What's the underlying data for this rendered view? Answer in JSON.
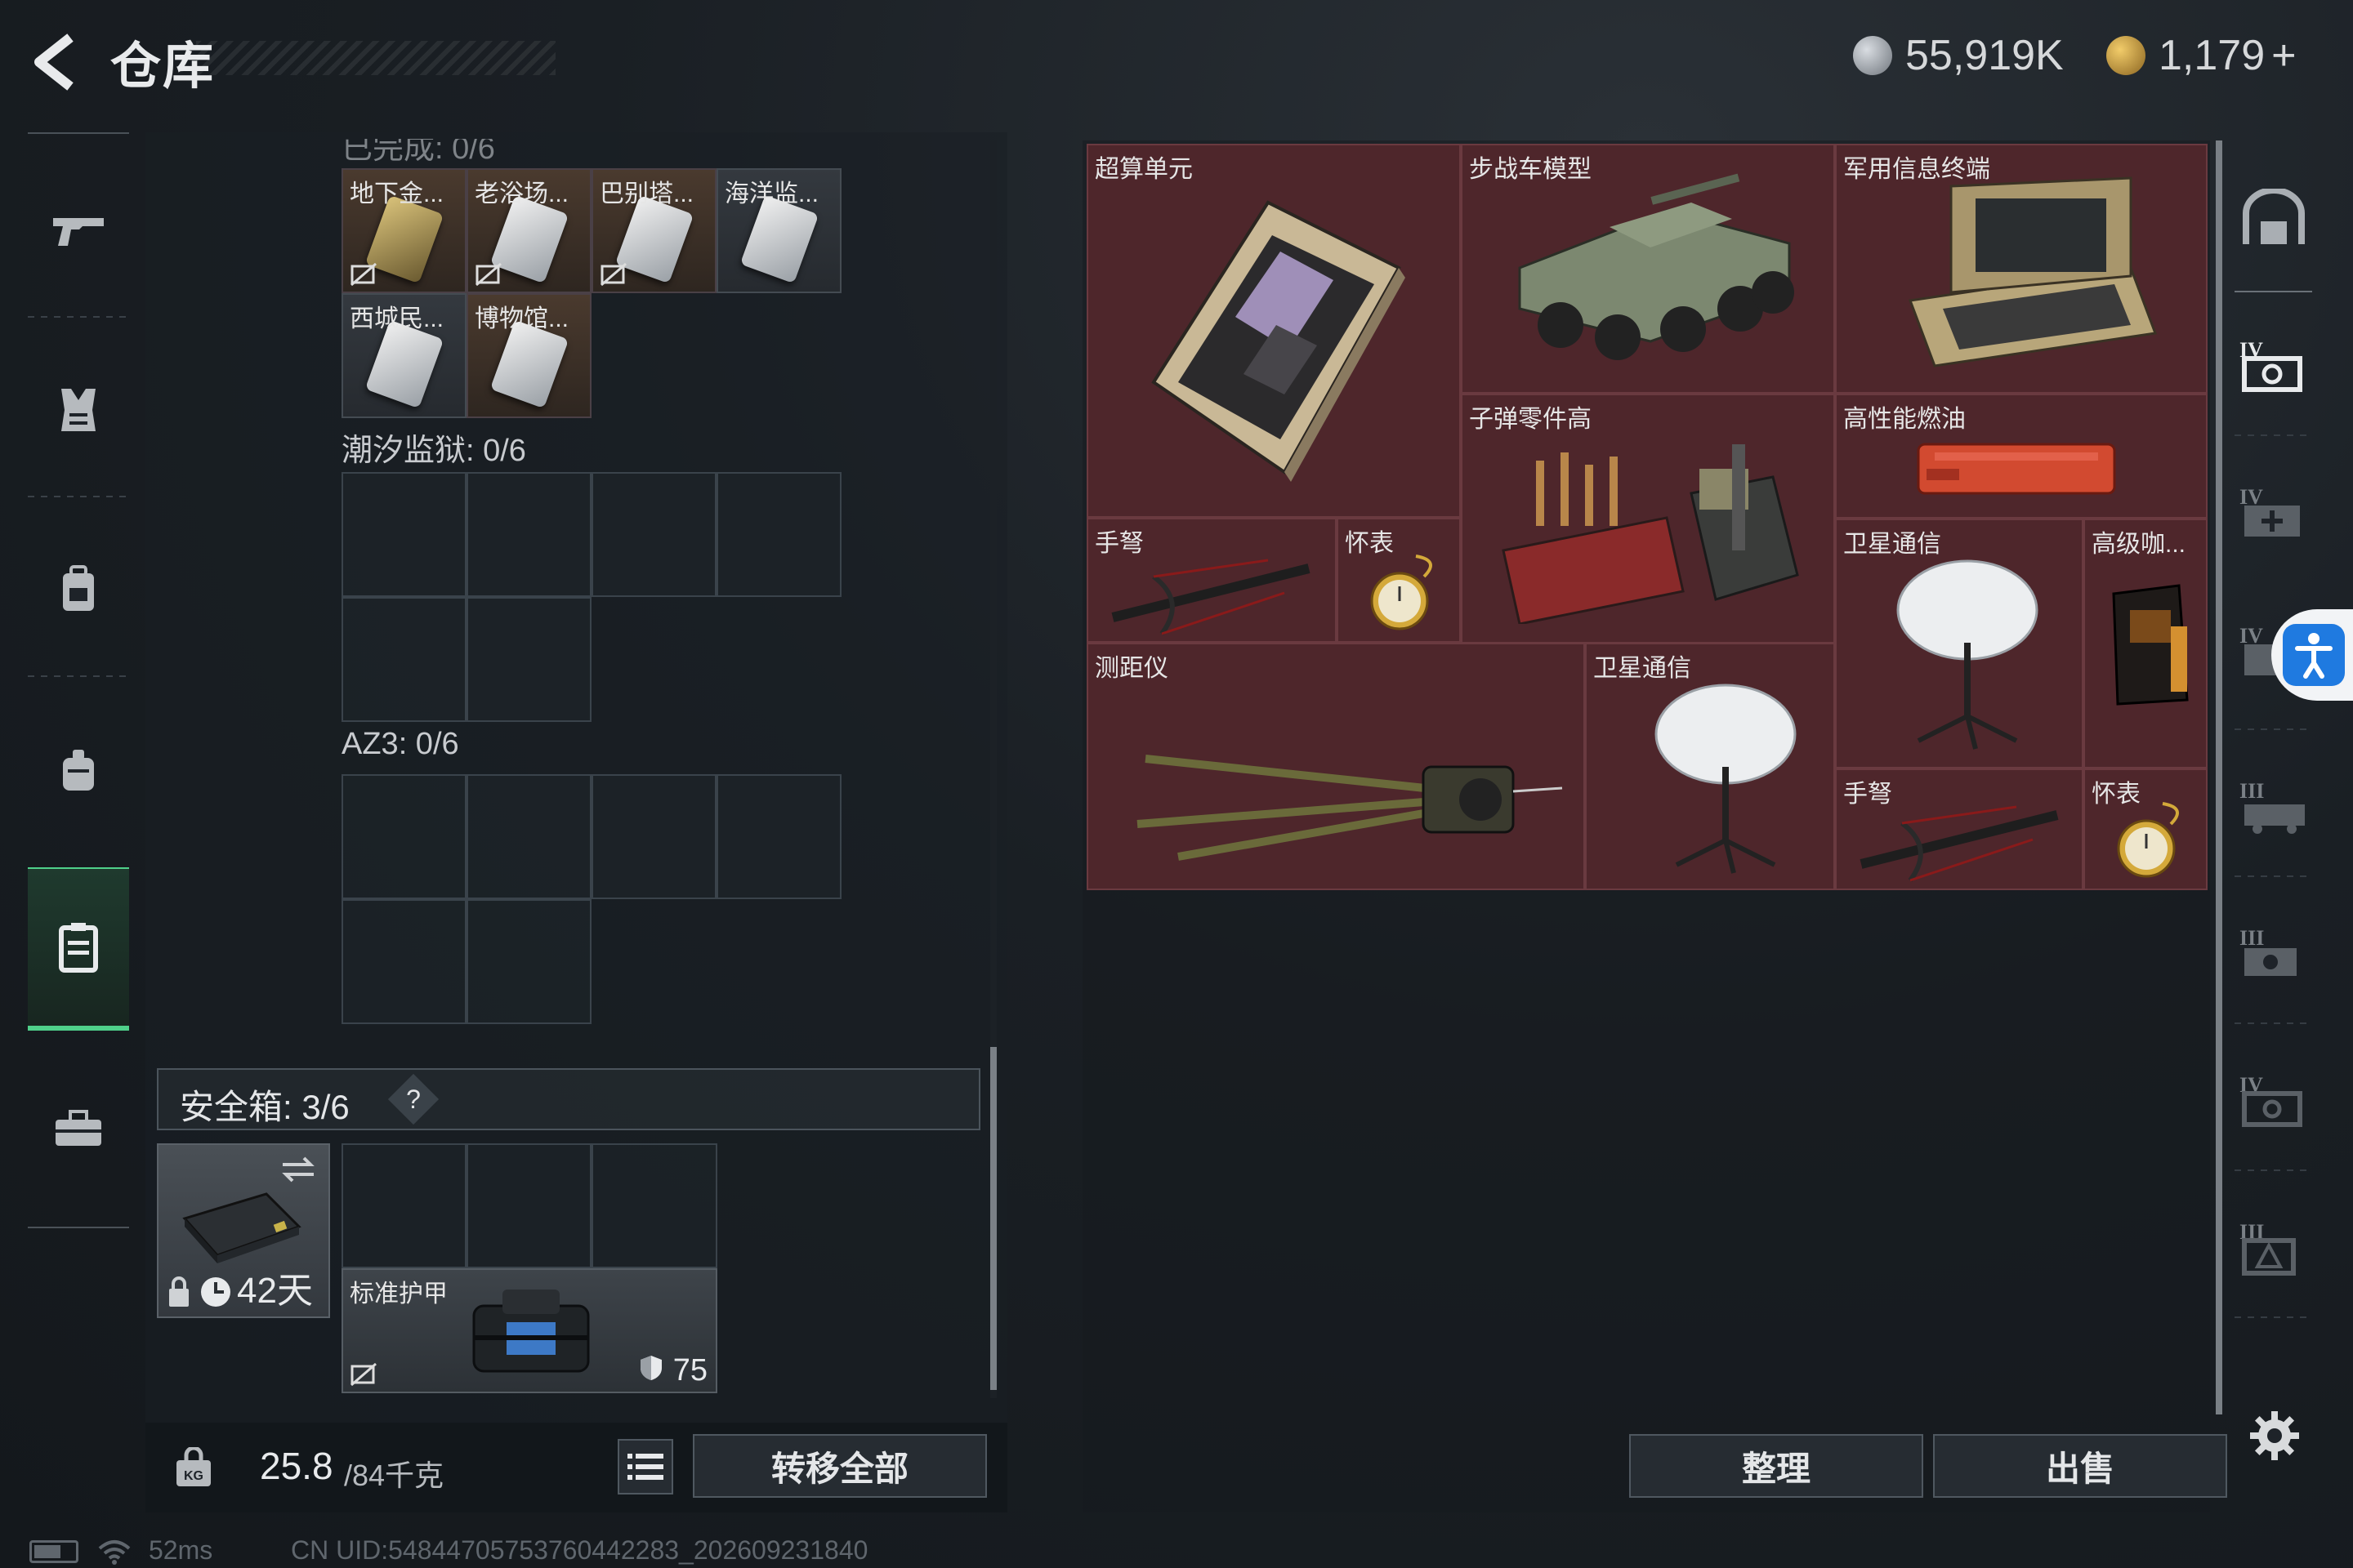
{
  "header": {
    "title": "仓库",
    "currency_silver": "55,919K",
    "currency_gold": "1,179",
    "add_label": "+"
  },
  "left_nav": {
    "items": [
      "weapon-icon",
      "armor-icon",
      "backpack-icon",
      "pouch-icon",
      "safebox-icon",
      "toolbox-icon"
    ],
    "active_index": 4
  },
  "containers": {
    "partial_label": "已完成: 0/6",
    "keys": [
      {
        "name": "地下金...",
        "variant": "gold"
      },
      {
        "name": "老浴场...",
        "variant": "silver"
      },
      {
        "name": "巴别塔...",
        "variant": "silver"
      },
      {
        "name": "海洋监...",
        "variant": "silver"
      },
      {
        "name": "西城民...",
        "variant": "silver"
      },
      {
        "name": "博物馆...",
        "variant": "silver"
      }
    ],
    "tide_prison_label": "潮汐监狱: 0/6",
    "az3_label": "AZ3: 0/6"
  },
  "safe_box": {
    "label": "安全箱: 3/6",
    "help": "?",
    "timer": "42天",
    "armor_name": "标准护甲",
    "armor_durability": "75"
  },
  "weight": {
    "current": "25.8",
    "capacity": "/84千克"
  },
  "buttons": {
    "transfer_all": "转移全部",
    "organize": "整理",
    "sell": "出售"
  },
  "stash_items": [
    {
      "name": "超算单元"
    },
    {
      "name": "步战车模型"
    },
    {
      "name": "军用信息终端"
    },
    {
      "name": "子弹零件高"
    },
    {
      "name": "高性能燃油"
    },
    {
      "name": "手弩"
    },
    {
      "name": "怀表"
    },
    {
      "name": "卫星通信"
    },
    {
      "name": "高级咖..."
    },
    {
      "name": "测距仪"
    },
    {
      "name": "卫星通信"
    },
    {
      "name": "手弩"
    },
    {
      "name": "怀表"
    }
  ],
  "right_tabs": [
    "home-icon",
    "tier-iv-container-icon",
    "tier-iv-medical-icon",
    "tier-iv-tab-icon",
    "tier-iii-vehicle-icon",
    "tier-iii-gear-icon",
    "tier-iv-chip-icon",
    "tier-iii-card-icon"
  ],
  "status_bar": {
    "ping": "52ms",
    "uid": "CN UID:548447057537604422­83_202609231840"
  },
  "colors": {
    "stash_bg": "#4a2428",
    "accent_green": "#4fd08a",
    "accessibility_blue": "#1f7ae0"
  }
}
